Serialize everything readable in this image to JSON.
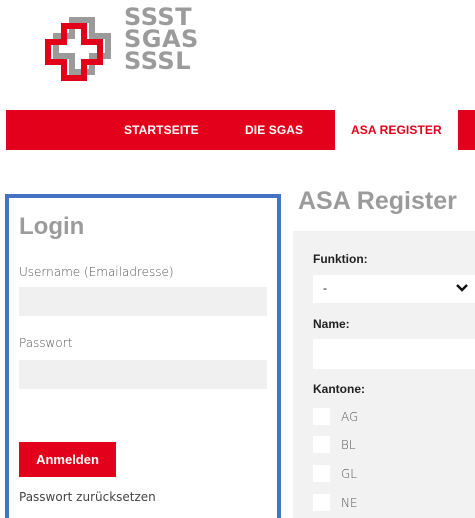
{
  "logo": {
    "lines": [
      "SSST",
      "SGAS",
      "SSSL"
    ],
    "cross_color": "#e2001a",
    "text_color": "#9b9b9b"
  },
  "nav": {
    "items": [
      {
        "label": "STARTSEITE",
        "active": false
      },
      {
        "label": "DIE SGAS",
        "active": false
      },
      {
        "label": "ASA REGISTER",
        "active": true
      }
    ],
    "bar_color": "#e2001a"
  },
  "login": {
    "title": "Login",
    "username_label": "Username (Emailadresse)",
    "username_value": "",
    "password_label": "Passwort",
    "password_value": "",
    "submit_label": "Anmelden",
    "reset_label": "Passwort zurücksetzen",
    "border_color": "#4472c4"
  },
  "asa": {
    "title": "ASA Register",
    "funktion_label": "Funktion:",
    "funktion_selected": "-",
    "name_label": "Name:",
    "name_value": "",
    "kantone_label": "Kantone:",
    "kantone": [
      "AG",
      "BL",
      "GL",
      "NE"
    ]
  }
}
